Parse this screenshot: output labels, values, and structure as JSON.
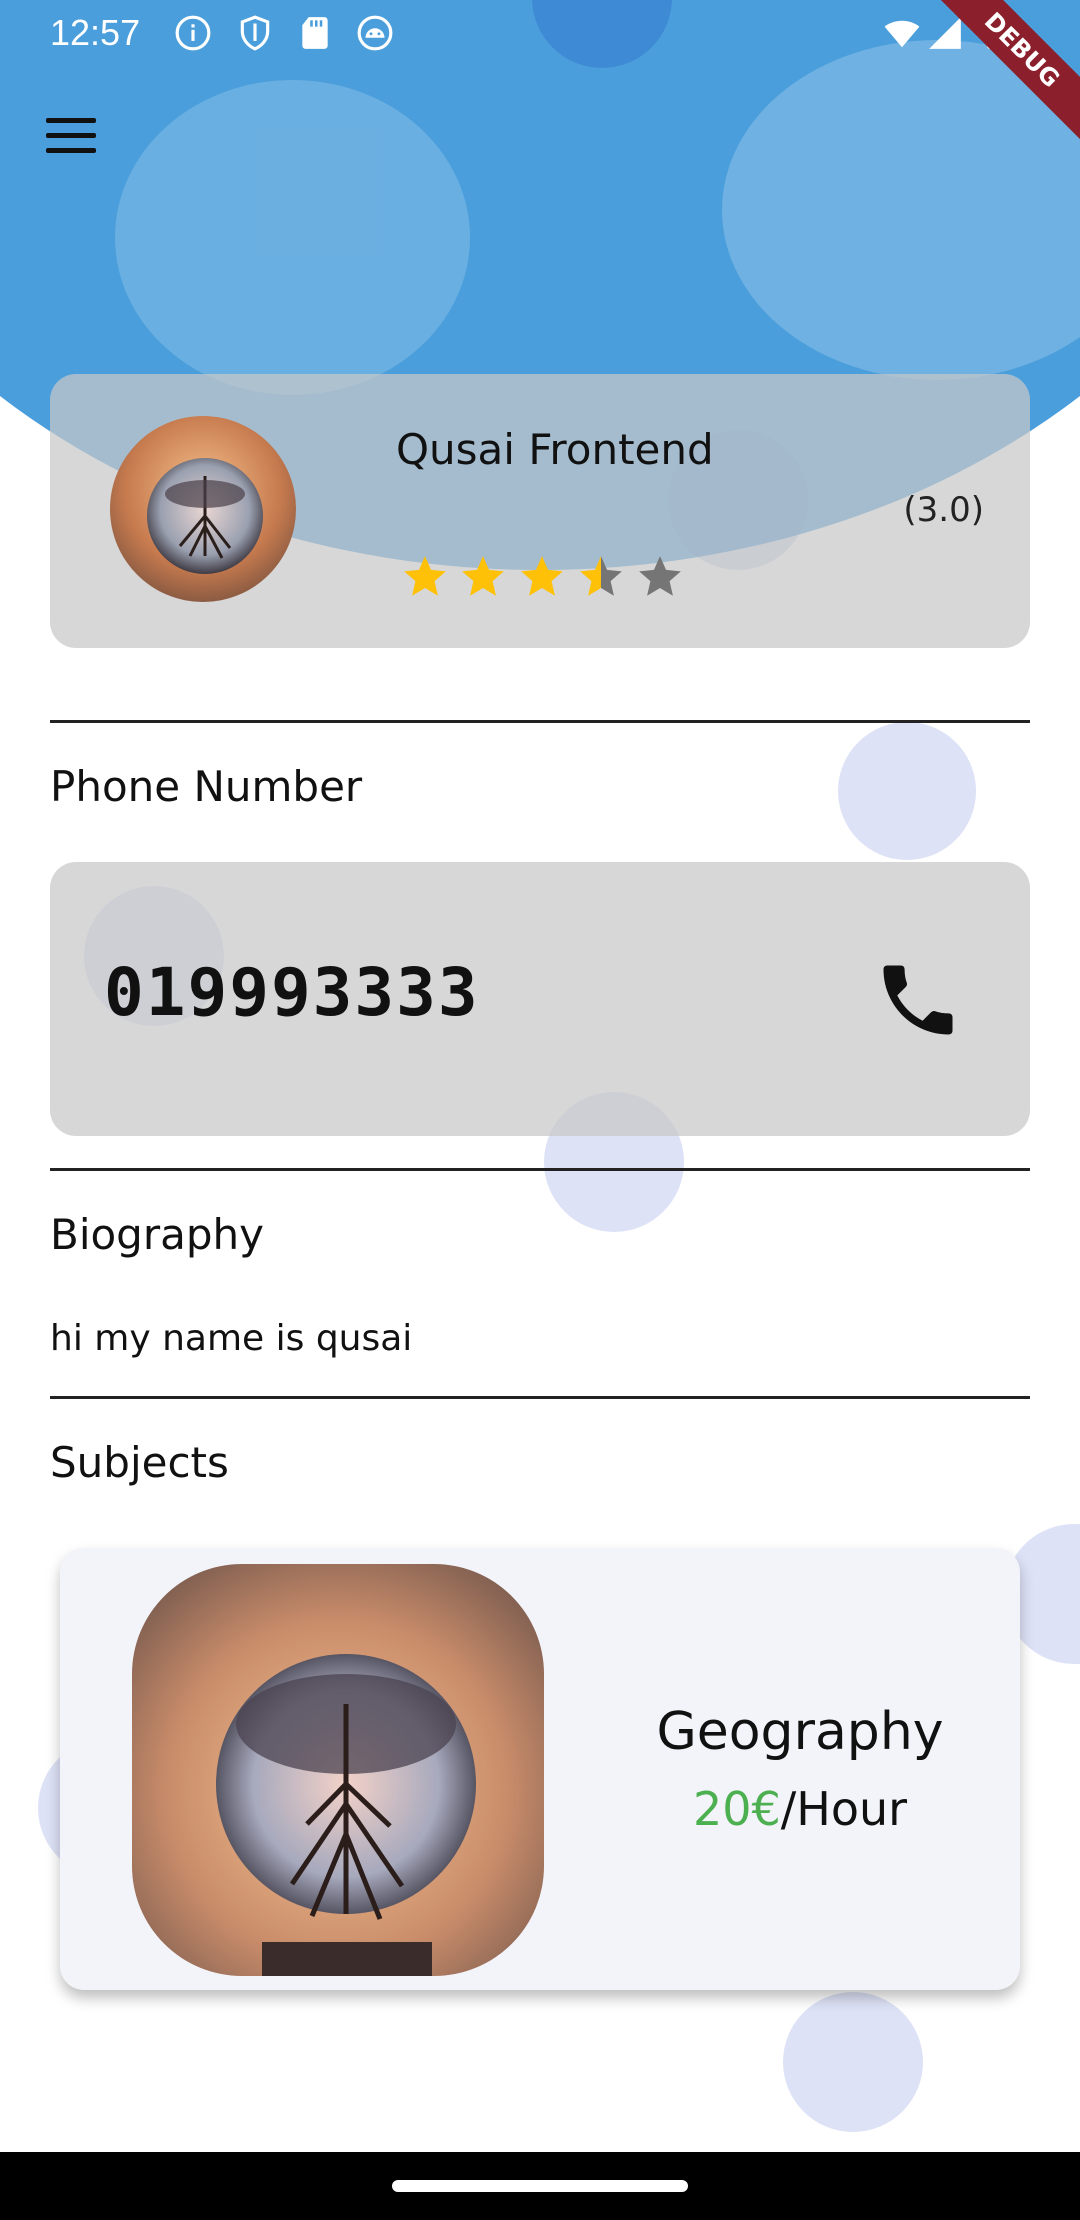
{
  "status_bar": {
    "time": "12:57",
    "left_icons": [
      "info-icon",
      "shield-icon",
      "sd-card-icon",
      "android-debug-icon"
    ],
    "right_icons": [
      "wifi-icon",
      "signal-icon",
      "battery-icon"
    ],
    "debug_label": "DEBUG"
  },
  "header": {
    "menu_icon": "hamburger-menu-icon"
  },
  "profile": {
    "name": "Qusai Frontend",
    "rating_text": "(3.0)",
    "rating_value": 3.5,
    "rating_max": 5,
    "star_color": "#ffc107",
    "star_empty_color": "#757575"
  },
  "phone": {
    "title": "Phone Number",
    "number": "019993333",
    "icon": "phone-icon"
  },
  "biography": {
    "title": "Biography",
    "text": "hi my name is qusai"
  },
  "subjects": {
    "title": "Subjects",
    "items": [
      {
        "name": "Geography",
        "price": "20€",
        "unit": "/Hour",
        "price_color": "#4caf50"
      }
    ]
  },
  "colors": {
    "accent": "#4a9edb",
    "card_bg": "#c8c8c8"
  }
}
